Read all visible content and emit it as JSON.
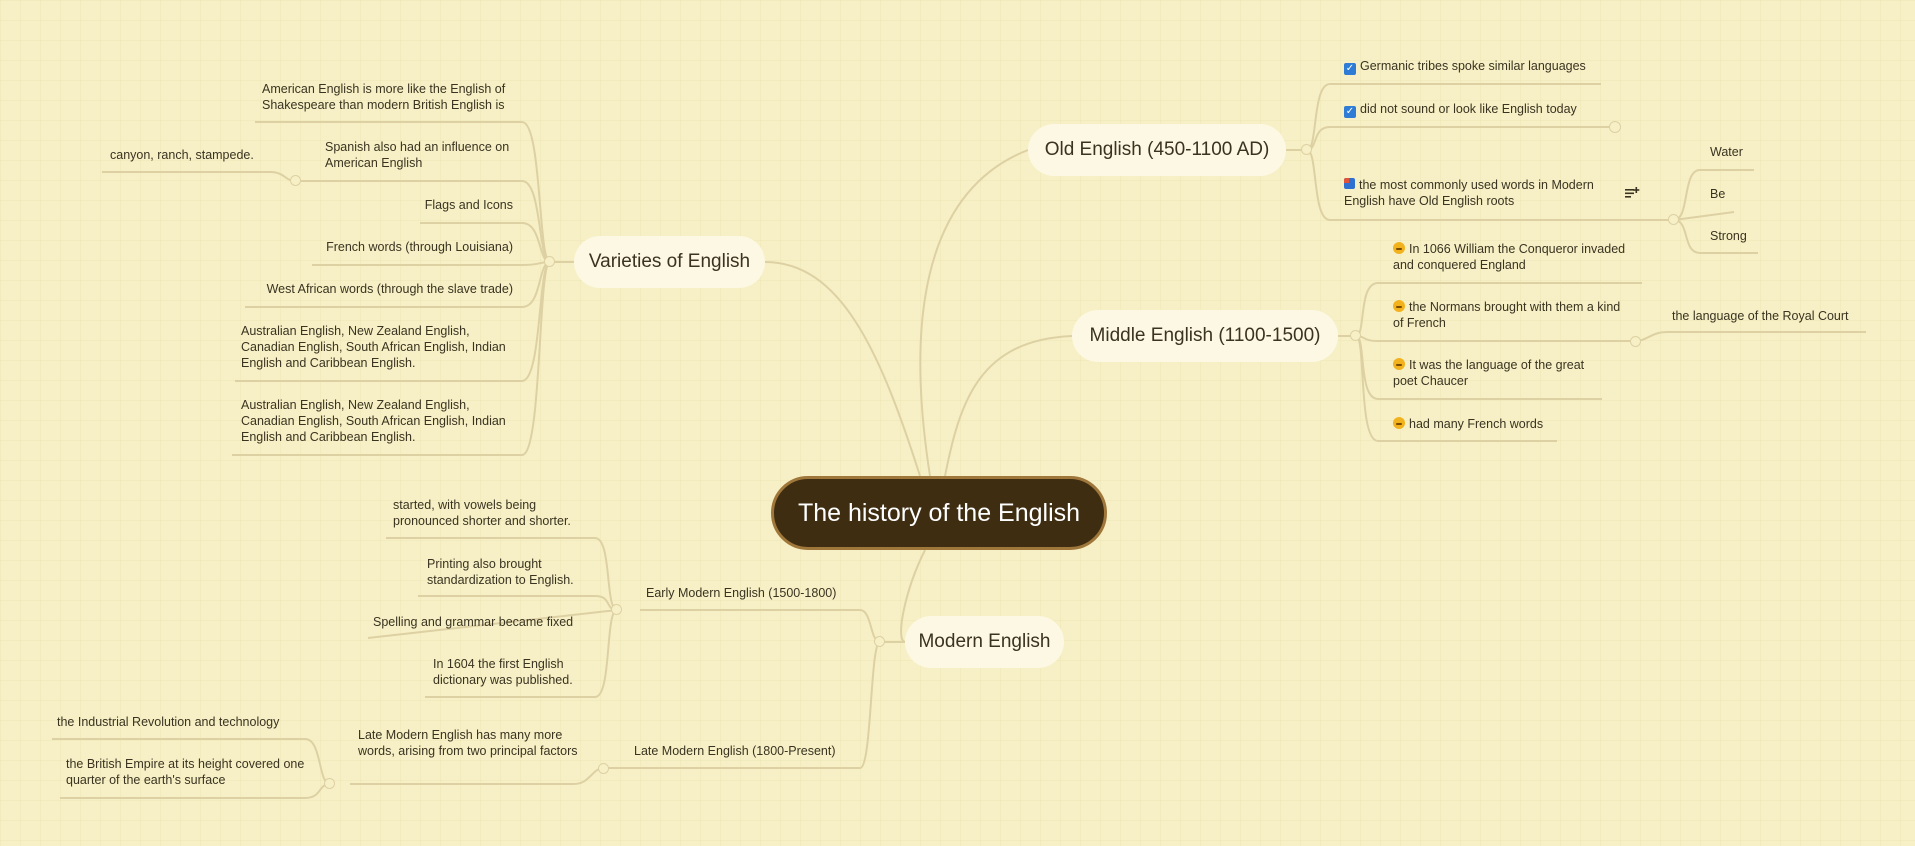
{
  "central": {
    "title": "The history of the English"
  },
  "old_english": {
    "title": "Old English (450-1100 AD)",
    "items": [
      "Germanic tribes spoke similar languages",
      "did not sound or look like English today",
      "the most commonly used words in Modern English have Old English roots"
    ],
    "roots": [
      "Water",
      "Be",
      "Strong"
    ],
    "icons": {
      "items_0": "checkbox-checked-icon",
      "items_1": "checkbox-checked-icon",
      "items_2": "flag-icon"
    }
  },
  "middle_english": {
    "title": "Middle English (1100-1500)",
    "items": [
      "In 1066 William the Conqueror invaded and conquered England",
      "the Normans brought with them a kind of French",
      "It was the language of the great poet Chaucer",
      "had many French words"
    ],
    "normans_child": "the language of the Royal Court",
    "icon": "smiley-icon"
  },
  "varieties": {
    "title": "Varieties of English",
    "items": [
      "American English is more like the English of Shakespeare than modern British English is",
      "Spanish also had an influence on American English",
      "Flags and Icons",
      "French words (through Louisiana)",
      "West African words (through the slave trade)",
      "Australian English, New Zealand English, Canadian English, South African English, Indian English and Caribbean English.",
      "Australian English, New Zealand English, Canadian English, South African English, Indian English and Caribbean English."
    ],
    "spanish_child": "canyon, ranch, stampede."
  },
  "modern": {
    "title": "Modern English",
    "early": {
      "title": "Early Modern English (1500-1800)",
      "items": [
        "started, with vowels being pronounced shorter and shorter.",
        "Printing also brought standardization to English.",
        "Spelling and grammar became fixed",
        "In 1604 the first English dictionary was published."
      ]
    },
    "late": {
      "title": "Late Modern English (1800-Present)",
      "item": "Late Modern English has many more words, arising from two principal factors",
      "factors": [
        "the Industrial Revolution and technology",
        "the British Empire at its height covered one quarter of the earth's surface"
      ]
    }
  },
  "colors": {
    "background": "#f7f0c6",
    "central_fill": "#3e2d11",
    "central_border": "#a0773a",
    "connector": "#ddd1a4",
    "topic_fill": "#fdf8e3"
  }
}
